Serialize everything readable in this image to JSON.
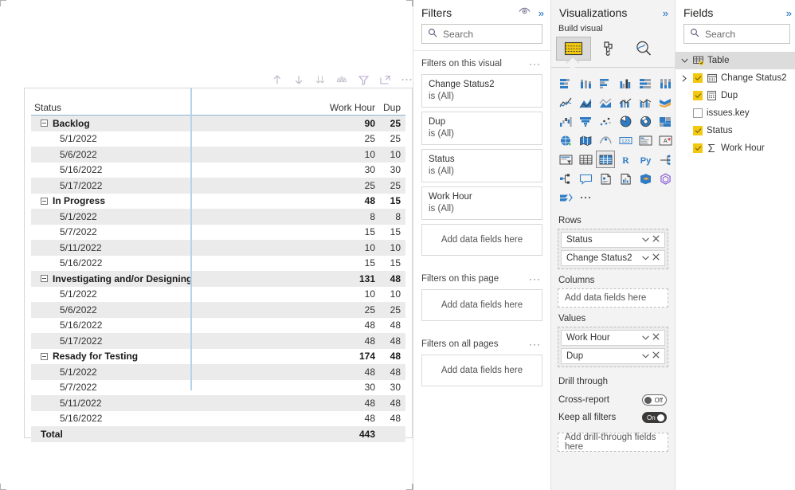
{
  "canvas": {
    "visual_toolbar": [
      {
        "name": "drill-up-icon",
        "title": "Drill up"
      },
      {
        "name": "drill-down-icon",
        "title": "Drill down"
      },
      {
        "name": "expand-all-icon",
        "title": "Expand all down one level"
      },
      {
        "name": "drill-mode-icon",
        "title": "Go to the next level in the hierarchy"
      },
      {
        "name": "filter-icon",
        "title": "Filters"
      },
      {
        "name": "focus-mode-icon",
        "title": "Focus mode"
      },
      {
        "name": "more-options-icon",
        "title": "More options"
      }
    ],
    "matrix": {
      "columns": [
        "Status",
        "Work Hour",
        "Dup"
      ],
      "rows": [
        {
          "type": "group",
          "label": "Backlog",
          "work_hour": "90",
          "dup": "25"
        },
        {
          "type": "detail",
          "label": "5/1/2022",
          "work_hour": "25",
          "dup": "25"
        },
        {
          "type": "detail",
          "label": "5/6/2022",
          "work_hour": "10",
          "dup": "10"
        },
        {
          "type": "detail",
          "label": "5/16/2022",
          "work_hour": "30",
          "dup": "30"
        },
        {
          "type": "detail",
          "label": "5/17/2022",
          "work_hour": "25",
          "dup": "25"
        },
        {
          "type": "group",
          "label": "In Progress",
          "work_hour": "48",
          "dup": "15"
        },
        {
          "type": "detail",
          "label": "5/1/2022",
          "work_hour": "8",
          "dup": "8"
        },
        {
          "type": "detail",
          "label": "5/7/2022",
          "work_hour": "15",
          "dup": "15"
        },
        {
          "type": "detail",
          "label": "5/11/2022",
          "work_hour": "10",
          "dup": "10"
        },
        {
          "type": "detail",
          "label": "5/16/2022",
          "work_hour": "15",
          "dup": "15"
        },
        {
          "type": "group",
          "label": "Investigating and/or Designing",
          "work_hour": "131",
          "dup": "48"
        },
        {
          "type": "detail",
          "label": "5/1/2022",
          "work_hour": "10",
          "dup": "10"
        },
        {
          "type": "detail",
          "label": "5/6/2022",
          "work_hour": "25",
          "dup": "25"
        },
        {
          "type": "detail",
          "label": "5/16/2022",
          "work_hour": "48",
          "dup": "48"
        },
        {
          "type": "detail",
          "label": "5/17/2022",
          "work_hour": "48",
          "dup": "48"
        },
        {
          "type": "group",
          "label": "Resady for Testing",
          "work_hour": "174",
          "dup": "48"
        },
        {
          "type": "detail",
          "label": "5/1/2022",
          "work_hour": "48",
          "dup": "48"
        },
        {
          "type": "detail",
          "label": "5/7/2022",
          "work_hour": "30",
          "dup": "30"
        },
        {
          "type": "detail",
          "label": "5/11/2022",
          "work_hour": "48",
          "dup": "48"
        },
        {
          "type": "detail",
          "label": "5/16/2022",
          "work_hour": "48",
          "dup": "48"
        },
        {
          "type": "total",
          "label": "Total",
          "work_hour": "443",
          "dup": ""
        }
      ]
    }
  },
  "filters_pane": {
    "title": "Filters",
    "search_placeholder": "Search",
    "sections": [
      {
        "title": "Filters on this visual",
        "cards": [
          {
            "field": "Change Status2",
            "value": "is (All)"
          },
          {
            "field": "Dup",
            "value": "is (All)"
          },
          {
            "field": "Status",
            "value": "is (All)"
          },
          {
            "field": "Work Hour",
            "value": "is (All)"
          }
        ],
        "dropzone": "Add data fields here"
      },
      {
        "title": "Filters on this page",
        "cards": [],
        "dropzone": "Add data fields here"
      },
      {
        "title": "Filters on all pages",
        "cards": [],
        "dropzone": "Add data fields here"
      }
    ]
  },
  "visualizations_pane": {
    "title": "Visualizations",
    "build_label": "Build visual",
    "tabs": [
      {
        "name": "build-visual-tab",
        "icon": "table-icon",
        "selected": true
      },
      {
        "name": "format-visual-tab",
        "icon": "paintbrush-icon",
        "selected": false
      },
      {
        "name": "analytics-tab",
        "icon": "magnifier-chart-icon",
        "selected": false
      }
    ],
    "gallery": [
      "stacked-bar-chart",
      "stacked-column-chart",
      "clustered-bar-chart",
      "clustered-column-chart",
      "100-stacked-bar-chart",
      "100-stacked-column-chart",
      "line-chart",
      "area-chart",
      "stacked-area-chart",
      "line-stacked-column-chart",
      "line-clustered-column-chart",
      "ribbon-chart",
      "waterfall-chart",
      "funnel-chart",
      "scatter-chart",
      "pie-chart",
      "donut-chart",
      "treemap",
      "map",
      "filled-map",
      "arcgis-map",
      "card",
      "multi-row-card",
      "kpi",
      "slicer",
      "table",
      "matrix",
      "r-script-visual",
      "python-visual",
      "key-influencers",
      "decomposition-tree",
      "q-and-a",
      "smart-narrative",
      "paginated-report",
      "powerapps",
      "power-automate",
      "get-more-visuals"
    ],
    "selected_visual": "matrix",
    "wells": [
      {
        "label": "Rows",
        "fields": [
          "Status",
          "Change Status2"
        ],
        "empty_text": ""
      },
      {
        "label": "Columns",
        "fields": [],
        "empty_text": "Add data fields here"
      },
      {
        "label": "Values",
        "fields": [
          "Work Hour",
          "Dup"
        ],
        "empty_text": ""
      }
    ],
    "drill_through": {
      "title": "Drill through",
      "options": [
        {
          "label": "Cross-report",
          "state": "Off",
          "on": false
        },
        {
          "label": "Keep all filters",
          "state": "On",
          "on": true
        }
      ],
      "dropzone": "Add drill-through fields here"
    }
  },
  "fields_pane": {
    "title": "Fields",
    "search_placeholder": "Search",
    "tree": [
      {
        "label": "Table",
        "level": 0,
        "kind": "table",
        "expanded": true,
        "checkbox": null,
        "icon": "table-icon"
      },
      {
        "label": "Change Status2",
        "level": 1,
        "kind": "field",
        "expandable": true,
        "checkbox": true,
        "icon": "calendar-icon"
      },
      {
        "label": "Dup",
        "level": 1,
        "kind": "field",
        "expandable": false,
        "checkbox": true,
        "icon": "calculator-icon"
      },
      {
        "label": "issues.key",
        "level": 1,
        "kind": "field",
        "expandable": false,
        "checkbox": false,
        "icon": null
      },
      {
        "label": "Status",
        "level": 1,
        "kind": "field",
        "expandable": false,
        "checkbox": true,
        "icon": null
      },
      {
        "label": "Work Hour",
        "level": 1,
        "kind": "field",
        "expandable": false,
        "checkbox": true,
        "icon": "sigma-icon"
      }
    ]
  },
  "colors": {
    "accent_yellow": "#f2c811",
    "accent_blue": "#0d6abf",
    "matrix_rule": "#8ab4d8",
    "row_stripe": "#ebebeb"
  }
}
